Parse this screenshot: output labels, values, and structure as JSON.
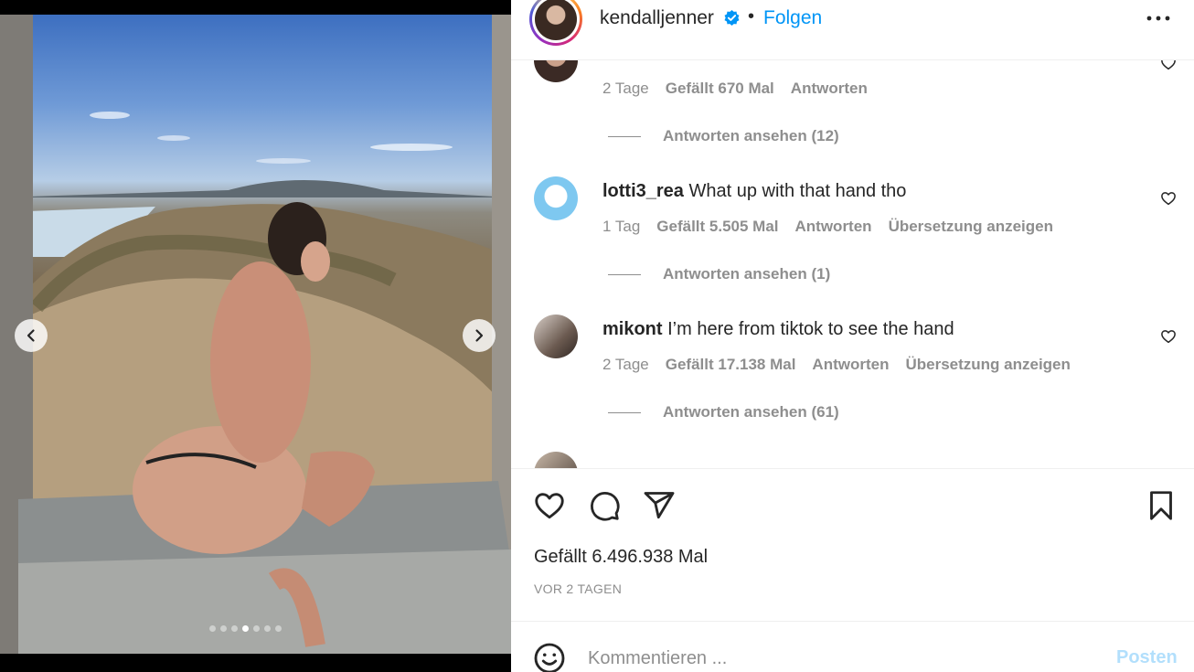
{
  "header": {
    "username": "kendalljenner",
    "separator": "•",
    "follow_label": "Folgen"
  },
  "comments": [
    {
      "meta_time": "2 Tage",
      "meta_likes": "Gefällt 670 Mal",
      "meta_reply": "Antworten",
      "view_replies": "Antworten ansehen (12)"
    },
    {
      "username": "lotti3_rea",
      "text": "What up with that hand tho",
      "meta_time": "1 Tag",
      "meta_likes": "Gefällt 5.505 Mal",
      "meta_reply": "Antworten",
      "meta_translate": "Übersetzung anzeigen",
      "view_replies": "Antworten ansehen (1)"
    },
    {
      "username": "mikont",
      "text": "I’m here from tiktok to see the hand",
      "meta_time": "2 Tage",
      "meta_likes": "Gefällt 17.138 Mal",
      "meta_reply": "Antworten",
      "meta_translate": "Übersetzung anzeigen",
      "view_replies": "Antworten ansehen (61)"
    }
  ],
  "carousel": {
    "total_slides": 7,
    "active_slide": 4
  },
  "post": {
    "likes_label": "Gefällt 6.496.938 Mal",
    "date_label": "VOR 2 TAGEN"
  },
  "compose": {
    "placeholder": "Kommentieren ...",
    "post_label": "Posten"
  },
  "icons": {
    "prev": "chevron-left-icon",
    "next": "chevron-right-icon",
    "verified": "verified-badge-icon",
    "more": "more-horizontal-icon",
    "like": "heart-icon",
    "comment": "comment-icon",
    "share": "share-icon",
    "save": "bookmark-icon",
    "emoji": "emoji-icon"
  },
  "colors": {
    "link_blue": "#0095f6",
    "post_disabled": "#b2dffc",
    "muted": "#8e8e8e",
    "text": "#262626"
  }
}
